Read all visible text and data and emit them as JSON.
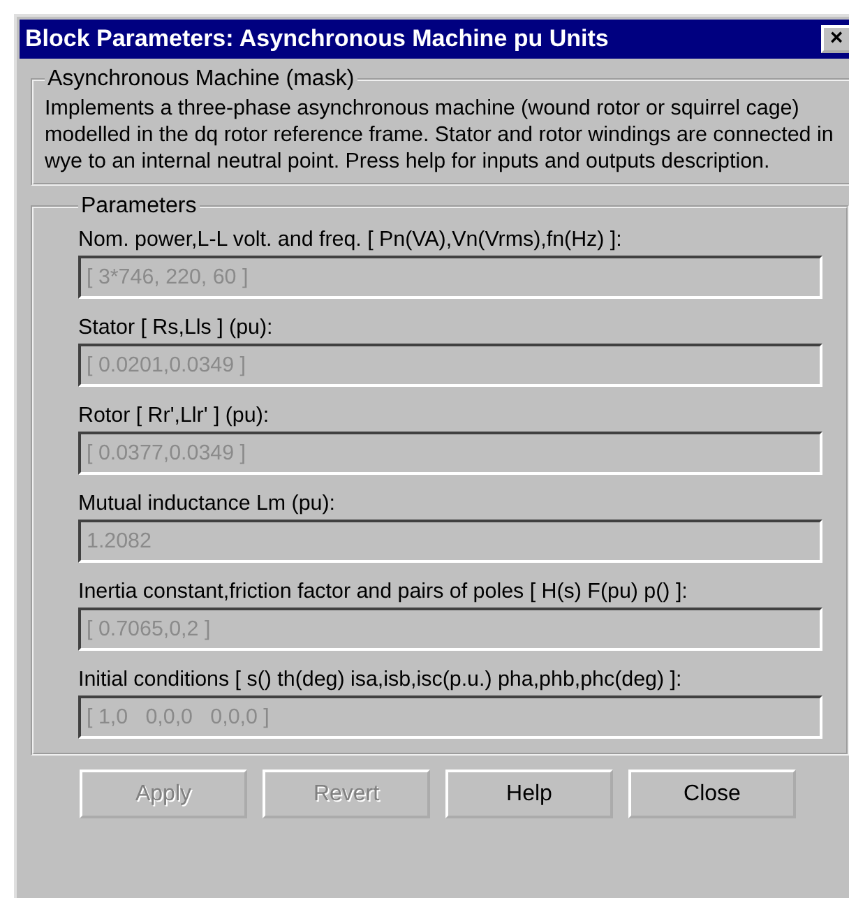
{
  "window": {
    "title": "Block Parameters: Asynchronous Machine pu Units",
    "close_symbol": "×"
  },
  "description": {
    "title": "Asynchronous Machine (mask)",
    "text": "Implements a three-phase asynchronous machine (wound rotor or squirrel cage) modelled in the dq rotor reference frame. Stator and rotor windings are connected in wye to an internal neutral point. Press help for inputs and outputs description."
  },
  "parameters": {
    "title": "Parameters",
    "fields": [
      {
        "label": "Nom. power,L-L volt. and freq. [ Pn(VA),Vn(Vrms),fn(Hz) ]:",
        "value": "[ 3*746, 220, 60 ]",
        "disabled": true
      },
      {
        "label": "Stator [ Rs,Lls ] (pu):",
        "value": "[ 0.0201,0.0349 ]",
        "disabled": true
      },
      {
        "label": "Rotor [ Rr',Llr' ] (pu):",
        "value": "[ 0.0377,0.0349 ]",
        "disabled": true
      },
      {
        "label": "Mutual inductance Lm (pu):",
        "value": "1.2082",
        "disabled": true
      },
      {
        "label": "Inertia constant,friction factor and pairs of poles [ H(s) F(pu) p() ]:",
        "value": "[ 0.7065,0,2 ]",
        "disabled": true
      },
      {
        "label": "Initial conditions [ s() th(deg)  isa,isb,isc(p.u.)  pha,phb,phc(deg) ]:",
        "value": "[ 1,0   0,0,0   0,0,0 ]",
        "disabled": true
      }
    ]
  },
  "buttons": [
    {
      "label": "Apply",
      "disabled": true
    },
    {
      "label": "Revert",
      "disabled": true
    },
    {
      "label": "Help",
      "disabled": false
    },
    {
      "label": "Close",
      "disabled": false
    }
  ]
}
